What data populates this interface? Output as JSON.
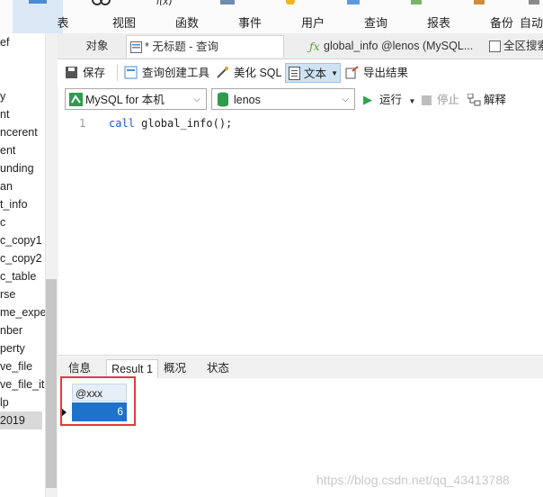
{
  "ribbon": {
    "items": [
      {
        "label": "表",
        "icon": "table-icon"
      },
      {
        "label": "视图",
        "icon": "view-icon"
      },
      {
        "label": "函数",
        "icon": "function-icon"
      },
      {
        "label": "事件",
        "icon": "event-icon"
      },
      {
        "label": "用户",
        "icon": "user-icon"
      },
      {
        "label": "查询",
        "icon": "query-icon"
      },
      {
        "label": "报表",
        "icon": "report-icon"
      },
      {
        "label": "备份",
        "icon": "backup-icon"
      },
      {
        "label": "自动",
        "icon": "automation-icon"
      }
    ]
  },
  "tree": {
    "items": [
      "ef",
      "",
      "",
      "y",
      "nt",
      "ncerent",
      "ent",
      "unding",
      "an",
      "t_info",
      "c",
      "c_copy1",
      "c_copy2",
      "c_table",
      "rse",
      "me_expe",
      "nber",
      "perty",
      "ve_file",
      "ve_file_ite",
      "lp",
      "2019"
    ]
  },
  "tabs": [
    {
      "label": "对象"
    },
    {
      "label": "* 无标题 - 查询"
    },
    {
      "label": "global_info @lenos (MySQL..."
    },
    {
      "label": "全区搜索"
    }
  ],
  "toolbar": {
    "save": "保存",
    "query_builder": "查询创建工具",
    "beautify": "美化 SQL",
    "text": "文本",
    "export": "导出结果"
  },
  "connection": {
    "server": "MySQL for 本机",
    "database": "lenos",
    "run": "运行",
    "stop": "停止",
    "explain": "解释"
  },
  "editor": {
    "line_number": "1",
    "keyword": "call",
    "rest": " global_info();"
  },
  "result_tabs": [
    "信息",
    "Result 1",
    "概况",
    "状态"
  ],
  "result_grid": {
    "column": "@xxx",
    "value": "6"
  },
  "watermark": "https://blog.csdn.net/qq_43413788",
  "colors": {
    "highlight": "#e53a3a",
    "selected_cell": "#1f72c9",
    "keyword": "#2055d6"
  }
}
